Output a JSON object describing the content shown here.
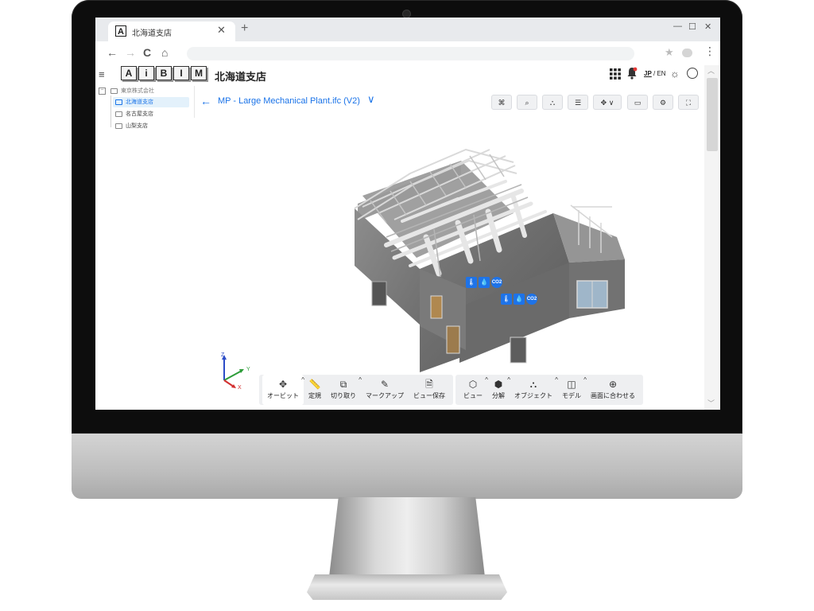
{
  "browser": {
    "tab_title": "北海道支店",
    "tab_favicon": "A",
    "tab_close": "✕",
    "new_tab": "+",
    "window_controls": [
      "—",
      "☐",
      "✕"
    ],
    "nav": {
      "back": "←",
      "forward": "→",
      "reload": "C",
      "home": "⌂"
    },
    "star": "★",
    "menu": "⋮"
  },
  "app": {
    "menu_glyph": "≡",
    "logo_letters": [
      "A",
      "i",
      "B",
      "I",
      "M"
    ],
    "header_title": "北海道支店",
    "lang": {
      "jp": "JP",
      "separator": " / ",
      "en": "EN"
    },
    "theme_glyph": "☼"
  },
  "sidebar": {
    "root": {
      "toggle": "−",
      "label": "東京株式会社"
    },
    "items": [
      {
        "label": "北海道支店",
        "selected": true
      },
      {
        "label": "名古屋支店",
        "selected": false
      },
      {
        "label": "山梨支店",
        "selected": false
      }
    ]
  },
  "model": {
    "back": "←",
    "title": "MP - Large Mechanical Plant.ifc (V2)",
    "chevron": "∨",
    "tools": [
      {
        "icon": "vr-icon",
        "glyph": "⌘"
      },
      {
        "icon": "search-icon",
        "glyph": "⌕"
      },
      {
        "icon": "tree-icon",
        "glyph": "⛬"
      },
      {
        "icon": "list-icon",
        "glyph": "☰"
      },
      {
        "icon": "navigation-icon",
        "glyph": "✥ ∨"
      },
      {
        "icon": "camera-icon",
        "glyph": "▭"
      },
      {
        "icon": "settings-icon",
        "glyph": "⚙"
      },
      {
        "icon": "fullscreen-icon",
        "glyph": "⛶"
      }
    ]
  },
  "axes": {
    "x": "X",
    "y": "Y",
    "z": "Z"
  },
  "sensors": [
    {
      "glyphs": [
        "🌡",
        "💧",
        "CO2"
      ]
    },
    {
      "glyphs": [
        "🌡",
        "💧",
        "CO2"
      ]
    }
  ],
  "toolbar": {
    "groups": [
      {
        "items": [
          {
            "label": "オービット",
            "icon": "orbit-icon",
            "glyph": "✥",
            "caret": "^",
            "active": true
          },
          {
            "label": "定規",
            "icon": "ruler-icon",
            "glyph": "📏",
            "caret": "",
            "active": false
          },
          {
            "label": "切り取り",
            "icon": "section-icon",
            "glyph": "⧉",
            "caret": "^",
            "active": false
          },
          {
            "label": "マークアップ",
            "icon": "markup-icon",
            "glyph": "✎",
            "caret": "",
            "active": false
          },
          {
            "label": "ビュー保存",
            "icon": "save-view-icon",
            "glyph": "🗎",
            "caret": "",
            "active": false
          }
        ]
      },
      {
        "items": [
          {
            "label": "ビュー",
            "icon": "view-cube-icon",
            "glyph": "⬡",
            "caret": "^",
            "active": false
          },
          {
            "label": "分解",
            "icon": "explode-icon",
            "glyph": "⬢",
            "caret": "^",
            "active": false
          },
          {
            "label": "オブジェクト",
            "icon": "objects-icon",
            "glyph": "⛬",
            "caret": "^",
            "active": false
          },
          {
            "label": "モデル",
            "icon": "model-icon",
            "glyph": "◫",
            "caret": "^",
            "active": false
          },
          {
            "label": "画面に合わせる",
            "icon": "fit-view-icon",
            "glyph": "⊕",
            "caret": "",
            "active": false
          }
        ]
      }
    ]
  },
  "scrollbar": {
    "up": "︿",
    "down": "﹀"
  }
}
